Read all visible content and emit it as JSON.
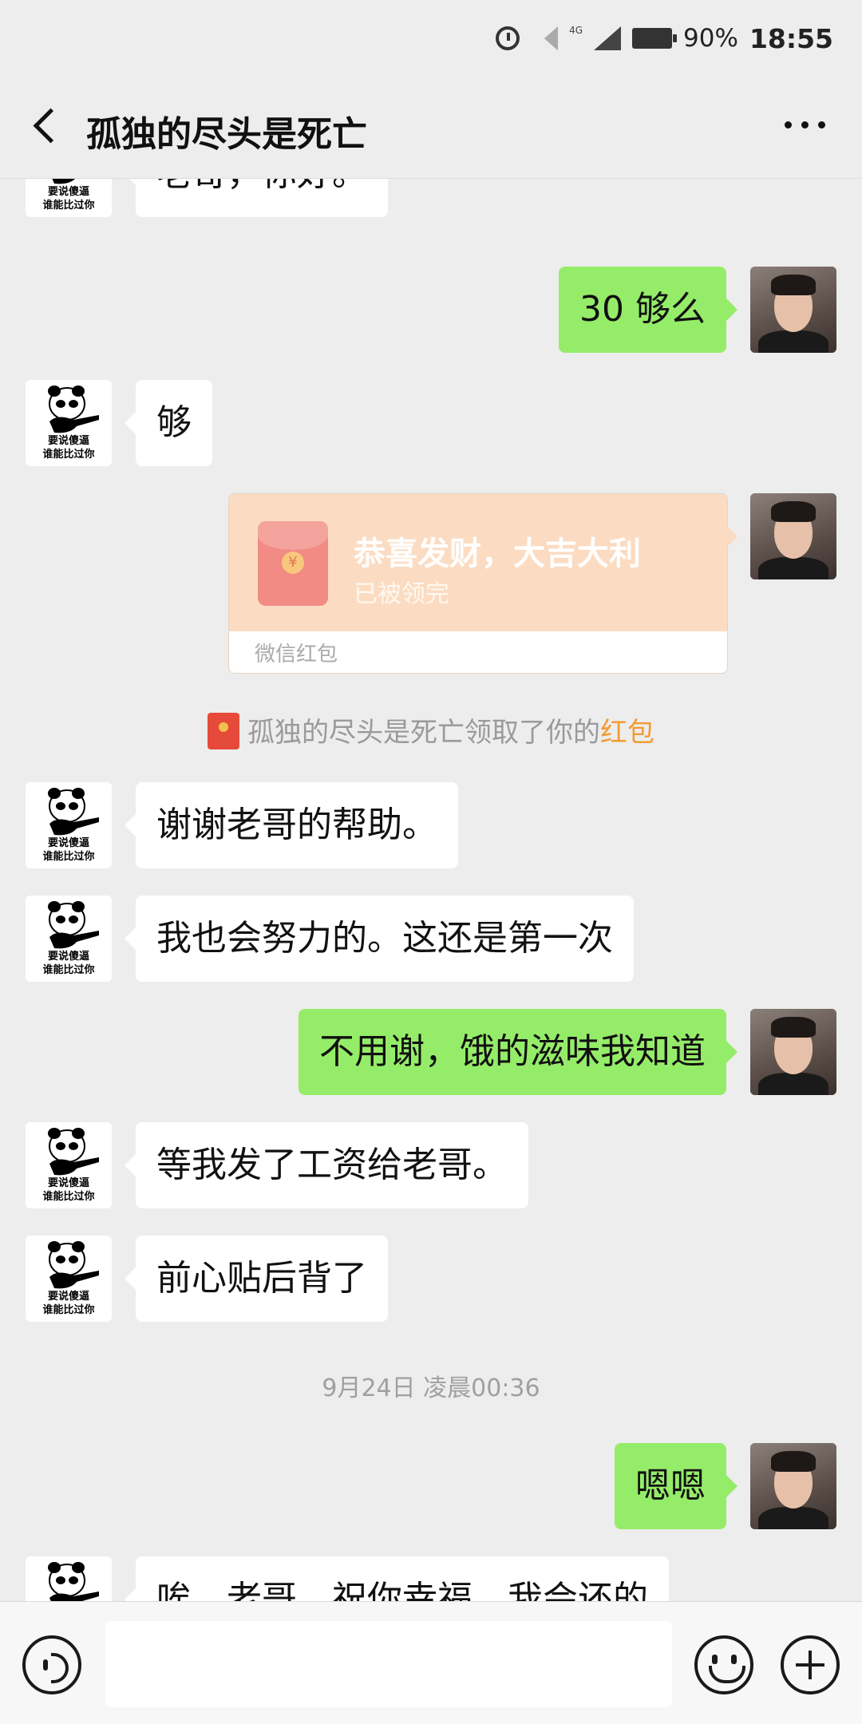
{
  "status_bar": {
    "network_label": "4G",
    "battery": "90%",
    "time": "18:55"
  },
  "header": {
    "title": "孤独的尽头是死亡"
  },
  "avatars": {
    "contact_caption_line1": "要说傻逼",
    "contact_caption_line2": "谁能比过你"
  },
  "messages": [
    {
      "side": "in",
      "text": "老哥，你好。"
    },
    {
      "side": "out",
      "text": "30 够么"
    },
    {
      "side": "in",
      "text": "够"
    },
    {
      "side": "out",
      "type": "red_packet",
      "title": "恭喜发财，大吉大利",
      "status": "已被领完",
      "footer": "微信红包"
    },
    {
      "side": "system",
      "text": "孤独的尽头是死亡领取了你的",
      "link": "红包"
    },
    {
      "side": "in",
      "text": "谢谢老哥的帮助。"
    },
    {
      "side": "in",
      "text": "我也会努力的。这还是第一次"
    },
    {
      "side": "out",
      "text": "不用谢，饿的滋味我知道"
    },
    {
      "side": "in",
      "text": "等我发了工资给老哥。"
    },
    {
      "side": "in",
      "text": "前心贴后背了"
    },
    {
      "side": "time",
      "text": "9月24日 凌晨00:36"
    },
    {
      "side": "out",
      "text": "嗯嗯"
    },
    {
      "side": "in",
      "text": "唉，老哥，祝你幸福，我会还的"
    }
  ],
  "colors": {
    "outgoing_bubble": "#95ec69",
    "incoming_bubble": "#ffffff",
    "background": "#ededed",
    "red_packet": "#fbdcc2",
    "link": "#f39a32"
  }
}
